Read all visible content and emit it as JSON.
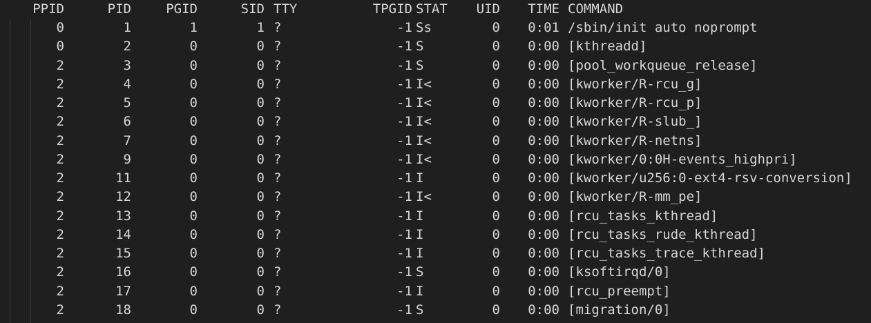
{
  "header": {
    "ppid": "PPID",
    "pid": "PID",
    "pgid": "PGID",
    "sid": "SID",
    "tty": "TTY",
    "tpgid": "TPGID",
    "stat": "STAT",
    "uid": "UID",
    "time": "TIME",
    "command": "COMMAND"
  },
  "rows": [
    {
      "ppid": "0",
      "pid": "1",
      "pgid": "1",
      "sid": "1",
      "tty": "?",
      "tpgid": "-1",
      "stat": "Ss",
      "uid": "0",
      "time": "0:01",
      "command": "/sbin/init auto noprompt"
    },
    {
      "ppid": "0",
      "pid": "2",
      "pgid": "0",
      "sid": "0",
      "tty": "?",
      "tpgid": "-1",
      "stat": "S",
      "uid": "0",
      "time": "0:00",
      "command": "[kthreadd]"
    },
    {
      "ppid": "2",
      "pid": "3",
      "pgid": "0",
      "sid": "0",
      "tty": "?",
      "tpgid": "-1",
      "stat": "S",
      "uid": "0",
      "time": "0:00",
      "command": "[pool_workqueue_release]"
    },
    {
      "ppid": "2",
      "pid": "4",
      "pgid": "0",
      "sid": "0",
      "tty": "?",
      "tpgid": "-1",
      "stat": "I<",
      "uid": "0",
      "time": "0:00",
      "command": "[kworker/R-rcu_g]"
    },
    {
      "ppid": "2",
      "pid": "5",
      "pgid": "0",
      "sid": "0",
      "tty": "?",
      "tpgid": "-1",
      "stat": "I<",
      "uid": "0",
      "time": "0:00",
      "command": "[kworker/R-rcu_p]"
    },
    {
      "ppid": "2",
      "pid": "6",
      "pgid": "0",
      "sid": "0",
      "tty": "?",
      "tpgid": "-1",
      "stat": "I<",
      "uid": "0",
      "time": "0:00",
      "command": "[kworker/R-slub_]"
    },
    {
      "ppid": "2",
      "pid": "7",
      "pgid": "0",
      "sid": "0",
      "tty": "?",
      "tpgid": "-1",
      "stat": "I<",
      "uid": "0",
      "time": "0:00",
      "command": "[kworker/R-netns]"
    },
    {
      "ppid": "2",
      "pid": "9",
      "pgid": "0",
      "sid": "0",
      "tty": "?",
      "tpgid": "-1",
      "stat": "I<",
      "uid": "0",
      "time": "0:00",
      "command": "[kworker/0:0H-events_highpri]"
    },
    {
      "ppid": "2",
      "pid": "11",
      "pgid": "0",
      "sid": "0",
      "tty": "?",
      "tpgid": "-1",
      "stat": "I",
      "uid": "0",
      "time": "0:00",
      "command": "[kworker/u256:0-ext4-rsv-conversion]"
    },
    {
      "ppid": "2",
      "pid": "12",
      "pgid": "0",
      "sid": "0",
      "tty": "?",
      "tpgid": "-1",
      "stat": "I<",
      "uid": "0",
      "time": "0:00",
      "command": "[kworker/R-mm_pe]"
    },
    {
      "ppid": "2",
      "pid": "13",
      "pgid": "0",
      "sid": "0",
      "tty": "?",
      "tpgid": "-1",
      "stat": "I",
      "uid": "0",
      "time": "0:00",
      "command": "[rcu_tasks_kthread]"
    },
    {
      "ppid": "2",
      "pid": "14",
      "pgid": "0",
      "sid": "0",
      "tty": "?",
      "tpgid": "-1",
      "stat": "I",
      "uid": "0",
      "time": "0:00",
      "command": "[rcu_tasks_rude_kthread]"
    },
    {
      "ppid": "2",
      "pid": "15",
      "pgid": "0",
      "sid": "0",
      "tty": "?",
      "tpgid": "-1",
      "stat": "I",
      "uid": "0",
      "time": "0:00",
      "command": "[rcu_tasks_trace_kthread]"
    },
    {
      "ppid": "2",
      "pid": "16",
      "pgid": "0",
      "sid": "0",
      "tty": "?",
      "tpgid": "-1",
      "stat": "S",
      "uid": "0",
      "time": "0:00",
      "command": "[ksoftirqd/0]"
    },
    {
      "ppid": "2",
      "pid": "17",
      "pgid": "0",
      "sid": "0",
      "tty": "?",
      "tpgid": "-1",
      "stat": "I",
      "uid": "0",
      "time": "0:00",
      "command": "[rcu_preempt]"
    },
    {
      "ppid": "2",
      "pid": "18",
      "pgid": "0",
      "sid": "0",
      "tty": "?",
      "tpgid": "-1",
      "stat": "S",
      "uid": "0",
      "time": "0:00",
      "command": "[migration/0]"
    }
  ]
}
